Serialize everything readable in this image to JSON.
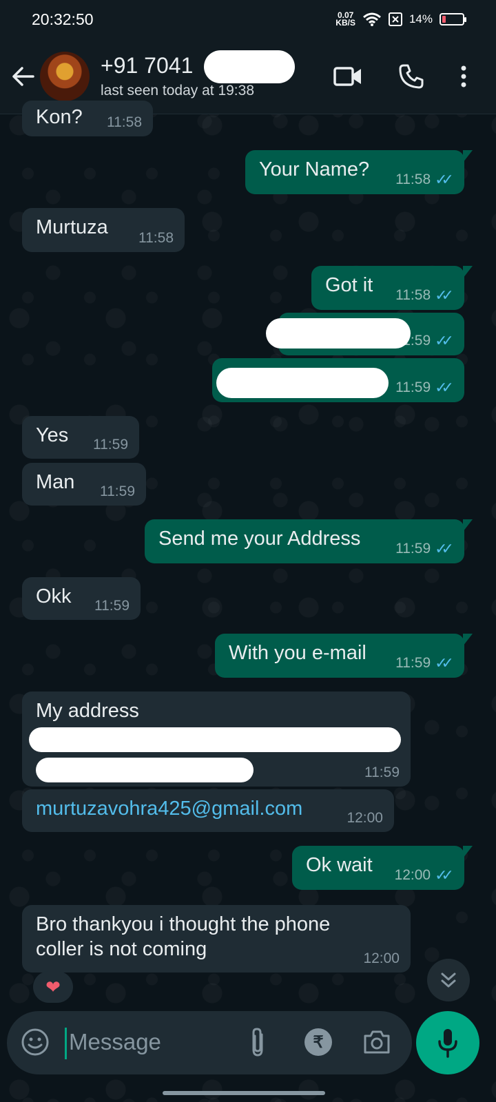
{
  "status_bar": {
    "time": "20:32:50",
    "net_speed_value": "0.07",
    "net_speed_unit": "KB/S",
    "battery": "14%"
  },
  "header": {
    "contact_name": "+91 7041",
    "last_seen": "last seen today at 19:38"
  },
  "messages": [
    {
      "text": "Kon?",
      "time": "11:58",
      "direction": "in"
    },
    {
      "text": "Your Name?",
      "time": "11:58",
      "direction": "out"
    },
    {
      "text": "Murtuza",
      "time": "11:58",
      "direction": "in"
    },
    {
      "text": "Got it",
      "time": "11:58",
      "direction": "out"
    },
    {
      "text": "",
      "time": "11:59",
      "direction": "out"
    },
    {
      "text": "",
      "time": "11:59",
      "direction": "out"
    },
    {
      "text": "Yes",
      "time": "11:59",
      "direction": "in"
    },
    {
      "text": "Man",
      "time": "11:59",
      "direction": "in"
    },
    {
      "text": "Send me your Address",
      "time": "11:59",
      "direction": "out"
    },
    {
      "text": "Okk",
      "time": "11:59",
      "direction": "in"
    },
    {
      "text": "With you e-mail",
      "time": "11:59",
      "direction": "out"
    },
    {
      "text": "My address",
      "time": "11:59",
      "direction": "in"
    },
    {
      "text": "murtuzavohra425@gmail.com",
      "time": "12:00",
      "direction": "in"
    },
    {
      "text": "Ok wait",
      "time": "12:00",
      "direction": "out"
    },
    {
      "line1": "Bro thankyou i thought the phone",
      "line2": "coller is not coming",
      "time": "12:00",
      "direction": "in"
    }
  ],
  "reaction": "❤",
  "input": {
    "placeholder": "Message",
    "currency_symbol": "₹"
  },
  "colors": {
    "background": "#0b141a",
    "incoming_bubble": "#1f2c34",
    "outgoing_bubble": "#005c4b",
    "accent": "#00a884",
    "read_ticks": "#53bdeb"
  },
  "icons": [
    "back-arrow-icon",
    "video-call-icon",
    "phone-icon",
    "more-icon",
    "emoji-icon",
    "attach-icon",
    "rupee-icon",
    "camera-icon",
    "mic-icon",
    "scroll-down-icon"
  ]
}
